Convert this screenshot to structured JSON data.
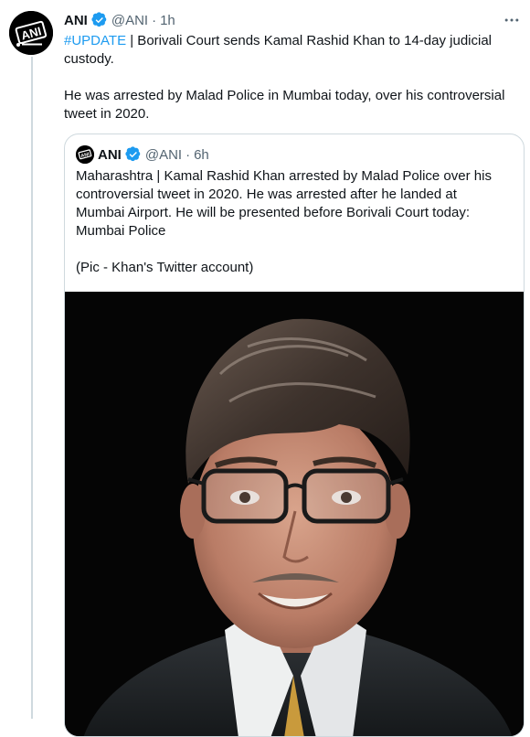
{
  "tweet": {
    "author": {
      "name": "ANI",
      "handle": "@ANI",
      "avatar_text": "ANI"
    },
    "separator": "·",
    "time": "1h",
    "hashtag": "#UPDATE",
    "text_line1_rest": " | Borivali Court sends Kamal Rashid Khan to 14-day judicial custody.",
    "text_para2": "He was arrested by Malad Police in Mumbai today, over his controversial tweet in 2020."
  },
  "quote": {
    "author": {
      "name": "ANI",
      "handle": "@ANI"
    },
    "separator": "·",
    "time": "6h",
    "text_para1": "Maharashtra | Kamal Rashid Khan arrested by Malad Police over his controversial tweet in 2020. He was arrested after he landed at Mumbai Airport. He will be presented before Borivali Court today: Mumbai Police",
    "text_para2": "(Pic - Khan's Twitter account)"
  },
  "icons": {
    "verified": "verified-badge-icon",
    "more": "more-options-icon"
  },
  "colors": {
    "link": "#1d9bf0",
    "secondary_text": "#536471",
    "border": "#cfd9de",
    "text": "#0f1419"
  }
}
